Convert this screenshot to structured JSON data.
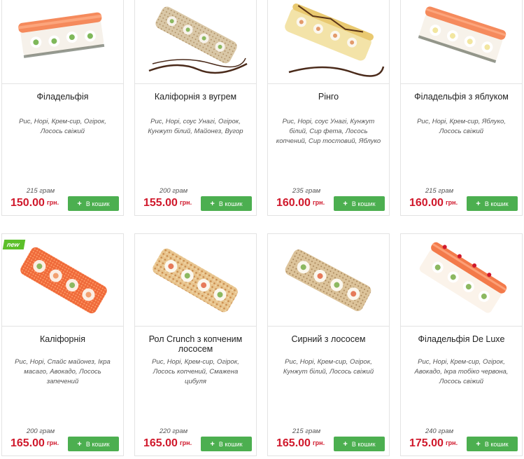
{
  "currency_label": "грн.",
  "add_to_cart_label": "В кошик",
  "badge_new_label": "new",
  "products": [
    {
      "name": "Філадельфія",
      "ingredients": "Рис, Норі, Крем-сир, Огірок, Лосось свіжий",
      "weight": "215 грам",
      "price": "150.00",
      "image_icon": "sushi-roll-salmon-icon",
      "badge": ""
    },
    {
      "name": "Каліфорнія з вугрем",
      "ingredients": "Рис, Норі, соус Унагі, Огірок, Кунжут білий, Майонез, Вугор",
      "weight": "200 грам",
      "price": "155.00",
      "image_icon": "sushi-roll-sesame-icon",
      "badge": ""
    },
    {
      "name": "Рінго",
      "ingredients": "Рис, Норі, соус Унагі, Кунжут білий, Сир фета, Лосось копчений, Сир тостовий, Яблуко",
      "weight": "235 грам",
      "price": "160.00",
      "image_icon": "sushi-roll-cheese-icon",
      "badge": ""
    },
    {
      "name": "Філадельфія з яблуком",
      "ingredients": "Рис, Норі, Крем-сир, Яблуко, Лосось свіжий",
      "weight": "215 грам",
      "price": "160.00",
      "image_icon": "sushi-roll-salmon-icon",
      "badge": ""
    },
    {
      "name": "Каліфорнія",
      "ingredients": "Рис, Норі, Спайс майонез, Ікра масаго, Авокадо, Лосось запечений",
      "weight": "200 грам",
      "price": "165.00",
      "image_icon": "sushi-roll-masago-icon",
      "badge": "new"
    },
    {
      "name": "Рол Crunch з копченим лососем",
      "ingredients": "Рис, Норі, Крем-сир, Огірок, Лосось копчений, Смажена цибуля",
      "weight": "220 грам",
      "price": "165.00",
      "image_icon": "sushi-roll-crunch-icon",
      "badge": ""
    },
    {
      "name": "Сирний з лососем",
      "ingredients": "Рис, Норі, Крем-сир, Огірок, Кунжут білий, Лосось свіжий",
      "weight": "215 грам",
      "price": "165.00",
      "image_icon": "sushi-roll-sesame-icon",
      "badge": ""
    },
    {
      "name": "Філадельфія De Luxe",
      "ingredients": "Рис, Норі, Крем-сир, Огірок, Авокадо, Ікра тобіко червона, Лосось свіжий",
      "weight": "240 грам",
      "price": "175.00",
      "image_icon": "sushi-roll-deluxe-icon",
      "badge": ""
    }
  ],
  "colors": {
    "price": "#d0192c",
    "button": "#4caf50",
    "badge": "#5cbf2a",
    "border": "#e3e3e3"
  }
}
